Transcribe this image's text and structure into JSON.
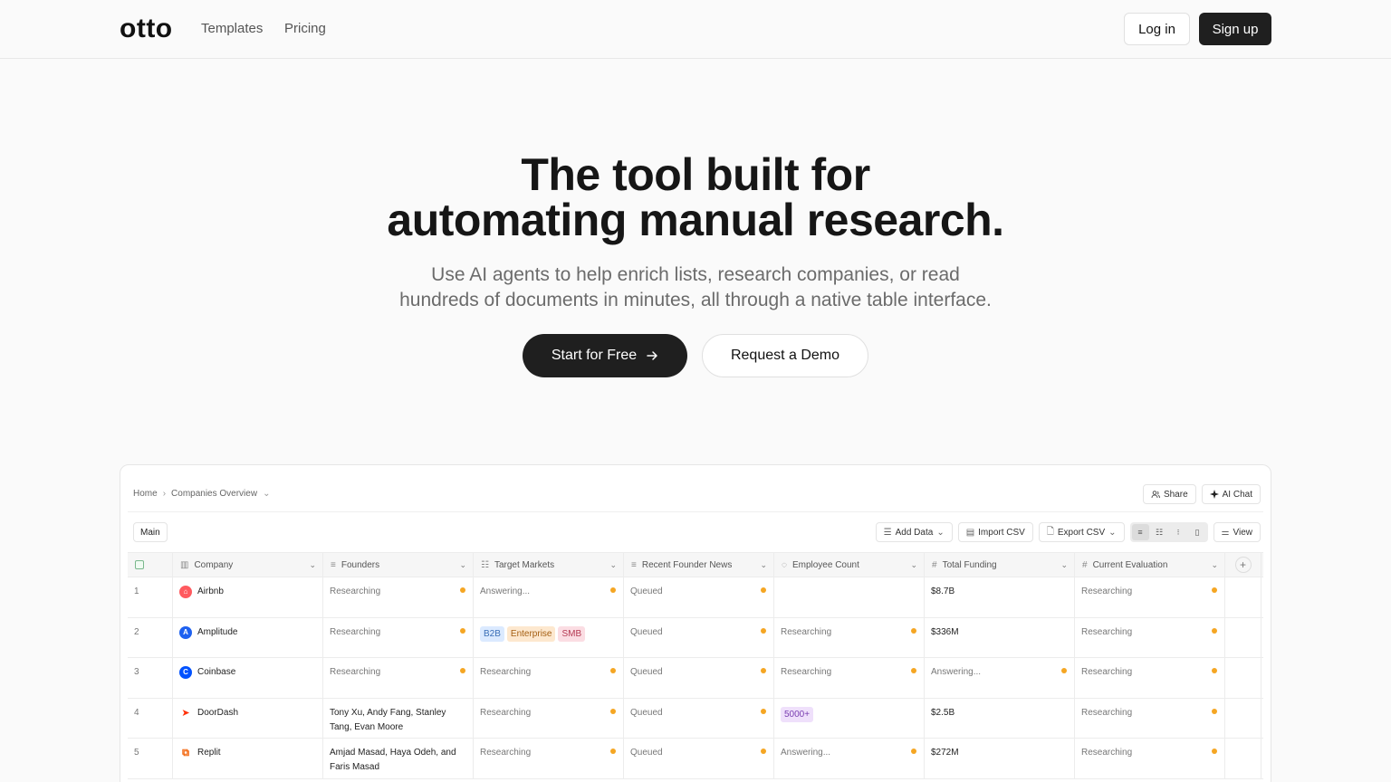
{
  "nav": {
    "logo": "otto",
    "links": [
      "Templates",
      "Pricing"
    ],
    "login": "Log in",
    "signup": "Sign up"
  },
  "hero": {
    "title_line1": "The tool built for",
    "title_line2": "automating manual research.",
    "sub_line1": "Use AI agents to help enrich lists, research companies, or read",
    "sub_line2": "hundreds of documents in minutes, all through a native table interface.",
    "cta_primary": "Start for Free",
    "cta_secondary": "Request a Demo"
  },
  "app": {
    "breadcrumb": [
      "Home",
      "Companies Overview"
    ],
    "share": "Share",
    "ai_chat": "AI Chat",
    "tab_main": "Main",
    "add_data": "Add Data",
    "import_csv": "Import CSV",
    "export_csv": "Export CSV",
    "view": "View",
    "columns": [
      "Company",
      "Founders",
      "Target Markets",
      "Recent Founder News",
      "Employee Count",
      "Total Funding",
      "Current Evaluation"
    ],
    "rows": [
      {
        "n": "1",
        "company": "Airbnb",
        "founders": "Researching",
        "markets": "Answering...",
        "news": "Queued",
        "employees": "",
        "funding": "$8.7B",
        "evaluation": "Researching"
      },
      {
        "n": "2",
        "company": "Amplitude",
        "founders": "Researching",
        "markets_tags": [
          "B2B",
          "Enterprise",
          "SMB"
        ],
        "news": "Queued",
        "employees": "Researching",
        "funding": "$336M",
        "evaluation": "Researching"
      },
      {
        "n": "3",
        "company": "Coinbase",
        "founders": "Researching",
        "markets": "Researching",
        "news": "Queued",
        "employees": "Researching",
        "funding": "Answering...",
        "evaluation": "Researching"
      },
      {
        "n": "4",
        "company": "DoorDash",
        "founders": "Tony Xu, Andy Fang, Stanley Tang, Evan Moore",
        "markets": "Researching",
        "news": "Queued",
        "employees_tag": "5000+",
        "funding": "$2.5B",
        "evaluation": "Researching"
      },
      {
        "n": "5",
        "company": "Replit",
        "founders": "Amjad Masad, Haya Odeh, and Faris Masad",
        "markets": "Researching",
        "news": "Queued",
        "employees": "Answering...",
        "funding": "$272M",
        "evaluation": "Researching"
      }
    ]
  },
  "colors": {
    "accent_dark": "#1f1f1f",
    "status_dot": "#f5a623",
    "airbnb": "#ff5a5f",
    "amplitude": "#1e61f0",
    "coinbase": "#0052ff",
    "doordash": "#ff3008",
    "replit": "#f26207"
  }
}
